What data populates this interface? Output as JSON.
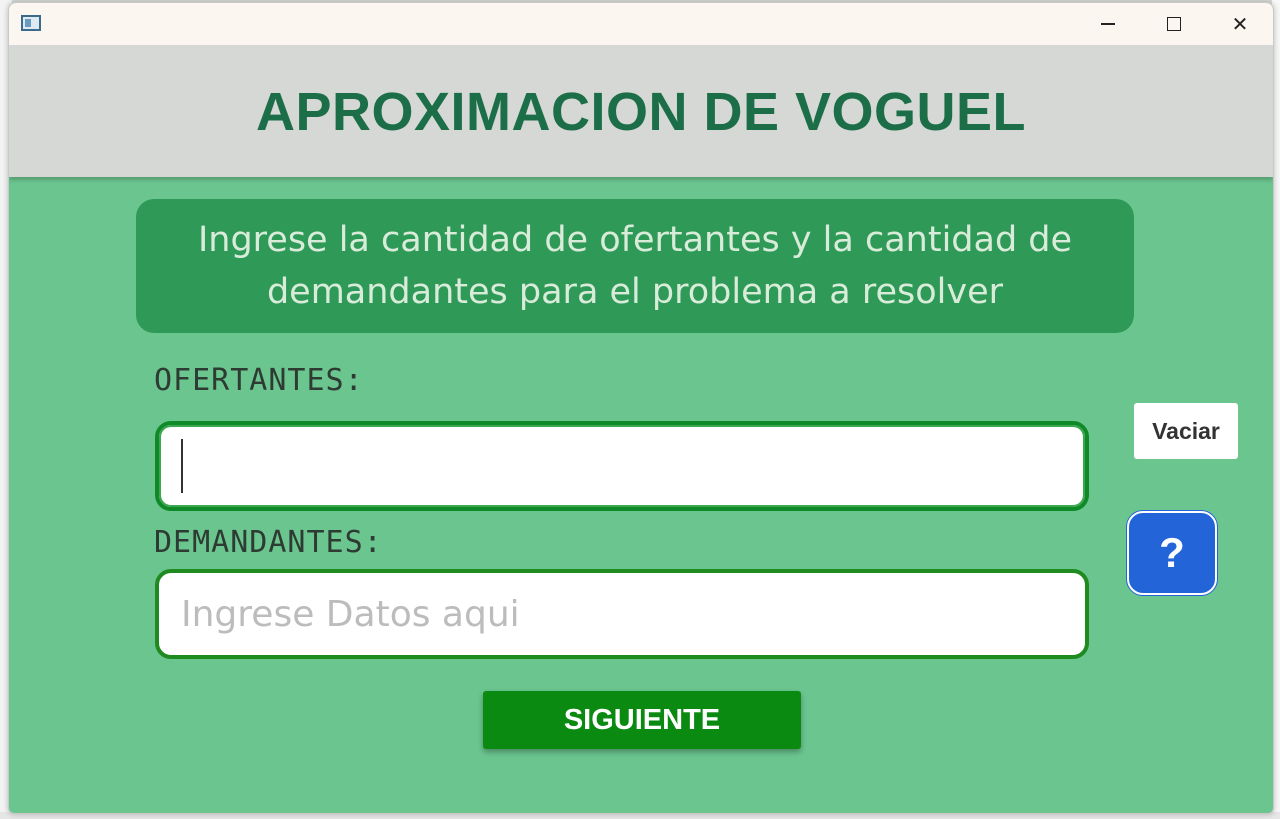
{
  "window": {
    "minimize_icon": "minimize-icon",
    "maximize_icon": "maximize-icon",
    "close_icon": "close-icon",
    "close_glyph": "✕"
  },
  "header": {
    "title": "APROXIMACION DE VOGUEL"
  },
  "instructions": {
    "text": "Ingrese la cantidad de ofertantes y la cantidad de demandantes para el problema a resolver"
  },
  "form": {
    "ofertantes_label": "OFERTANTES:",
    "ofertantes_value": "",
    "demandantes_label": "DEMANDANTES:",
    "demandantes_value": "",
    "demandantes_placeholder": "Ingrese Datos aqui"
  },
  "buttons": {
    "clear_label": "Vaciar",
    "help_label": "?",
    "next_label": "SIGUIENTE"
  },
  "colors": {
    "background": "#6bc58f",
    "header_bg": "#d5d8d5",
    "title": "#1c6e49",
    "instructions_bg": "#2f9a58",
    "next_button": "#0a8a10",
    "help_button": "#2364d8"
  }
}
